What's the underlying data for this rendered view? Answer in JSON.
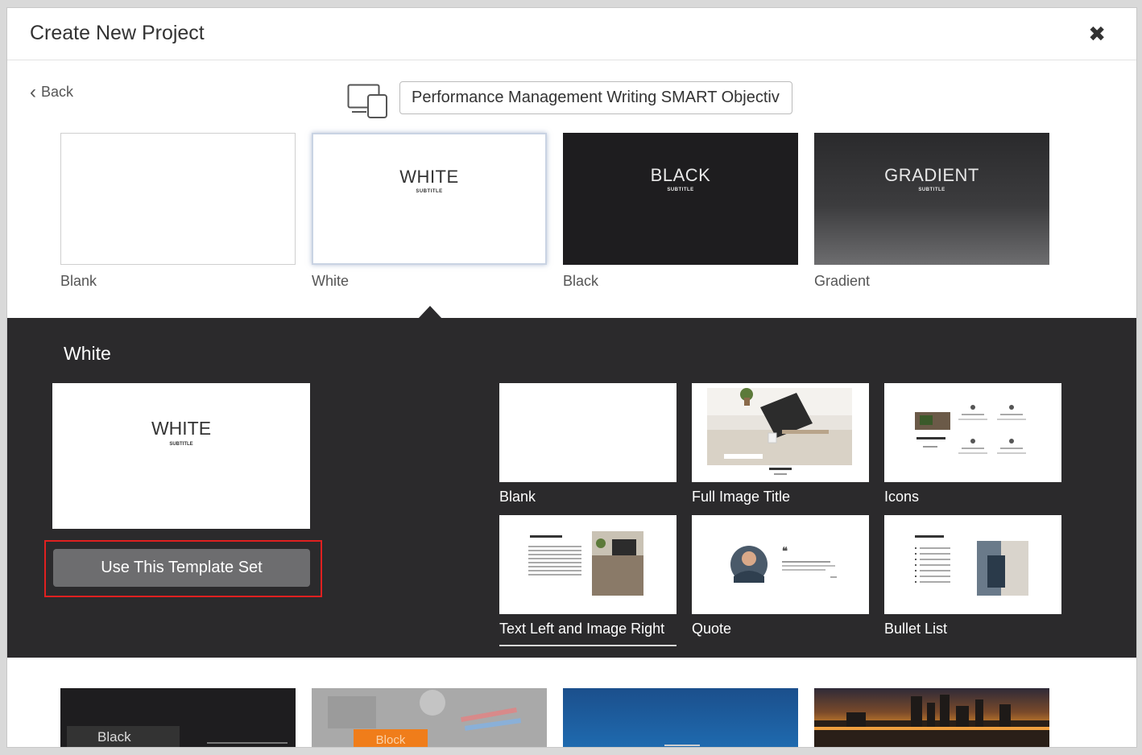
{
  "dialog": {
    "title": "Create New Project",
    "close_label": "✖"
  },
  "toolbar": {
    "back_label": "Back",
    "project_name": "Performance Management Writing SMART Objectiv"
  },
  "themes": [
    {
      "label": "Blank",
      "preview_title": "",
      "preview_subtitle": ""
    },
    {
      "label": "White",
      "preview_title": "WHITE",
      "preview_subtitle": "SUBTITLE"
    },
    {
      "label": "Black",
      "preview_title": "BLACK",
      "preview_subtitle": "SUBTITLE"
    },
    {
      "label": "Gradient",
      "preview_title": "GRADIENT",
      "preview_subtitle": "SUBTITLE"
    }
  ],
  "panel": {
    "title": "White",
    "preview_title": "WHITE",
    "preview_subtitle": "SUBTITLE",
    "use_button": "Use This Template Set",
    "layouts": [
      {
        "label": "Blank"
      },
      {
        "label": "Full Image Title"
      },
      {
        "label": "Icons"
      },
      {
        "label": "Text Left and Image Right"
      },
      {
        "label": "Quote"
      },
      {
        "label": "Bullet List"
      }
    ]
  },
  "more_themes": [
    {
      "label": "Black"
    },
    {
      "label": "Block"
    }
  ],
  "colors": {
    "panel_bg": "#2b2a2c",
    "button_bg": "#6d6d6f",
    "highlight": "#e02020"
  }
}
